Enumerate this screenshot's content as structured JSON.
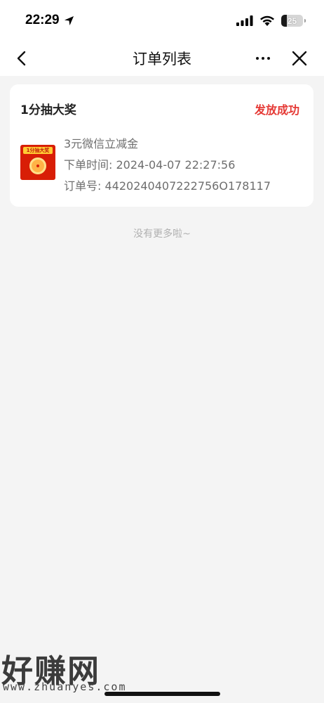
{
  "status_bar": {
    "time": "22:29",
    "battery_level": "25",
    "battery_fraction": 0.25,
    "icons": [
      "location-arrow-icon",
      "cellular-signal-icon",
      "wifi-icon",
      "battery-icon"
    ]
  },
  "nav": {
    "title": "订单列表",
    "icons": [
      "back-chevron-icon",
      "more-dots-icon",
      "close-icon"
    ]
  },
  "orders": [
    {
      "campaign": "1分抽大奖",
      "status": "发放成功",
      "status_color": "#e53935",
      "thumb_text": "1分抽大奖",
      "item_name": "3元微信立减金",
      "order_time_label": "下单时间: 2024-04-07 22:27:56",
      "order_no_label": "订单号: 4420240407222756O178117"
    }
  ],
  "footer_text": "没有更多啦~",
  "watermark": {
    "logo": "好赚网",
    "url": "www.zhuanyes.com"
  }
}
